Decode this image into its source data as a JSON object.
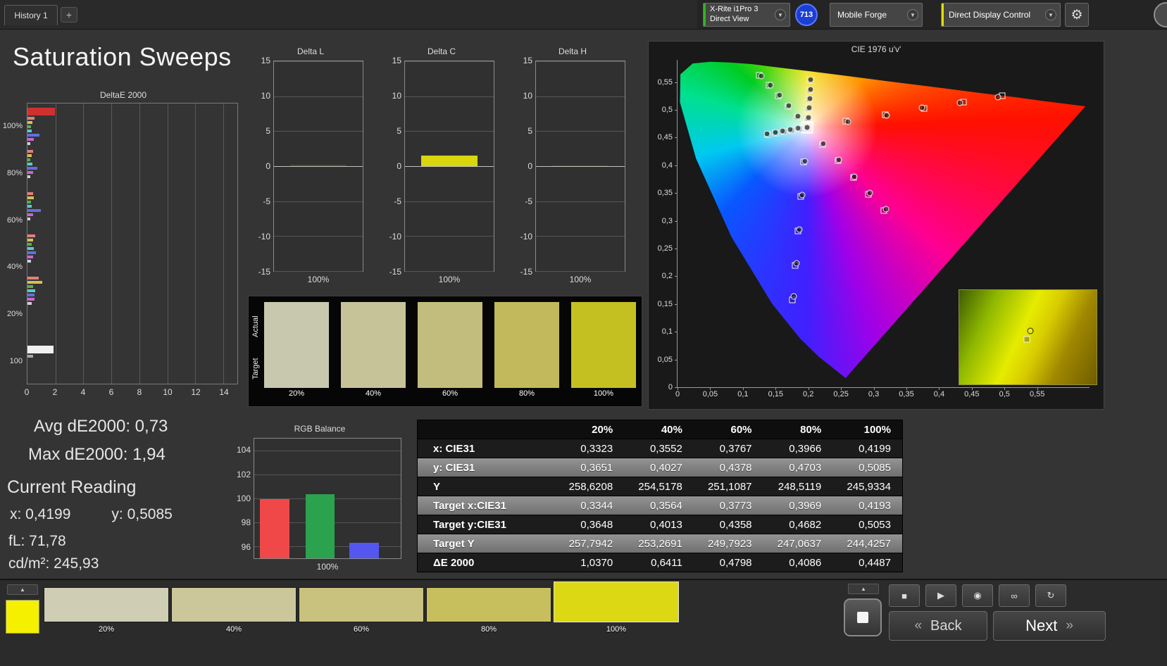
{
  "header": {
    "tab_label": "History 1",
    "add_tab_label": "+",
    "meter": {
      "line1": "X-Rite i1Pro 3",
      "line2": "Direct View",
      "badge": "713",
      "accent": "#35b324"
    },
    "source": {
      "label": "Mobile Forge"
    },
    "control": {
      "label": "Direct Display Control",
      "accent": "#e0de00"
    },
    "chevron": "▼",
    "gear_icon": "⚙"
  },
  "page": {
    "title": "Saturation Sweeps"
  },
  "stats": {
    "avg_label": "Avg dE2000: 0,73",
    "max_label": "Max dE2000: 1,94",
    "current_heading": "Current Reading",
    "x_label": "x: 0,4199",
    "y_label": "y: 0,5085",
    "fl_label": "fL: 71,78",
    "cd_label": "cd/m²: 245,93"
  },
  "swatch_panel": {
    "row_labels": [
      "Actual",
      "Target"
    ],
    "levels": [
      "20%",
      "40%",
      "60%",
      "80%",
      "100%"
    ],
    "colors": [
      "#c8c8af",
      "#c6c399",
      "#c3bd7d",
      "#c1b95c",
      "#c4c022"
    ]
  },
  "footer": {
    "current_patch_color": "#f4f000",
    "expand_icon": "▲",
    "big_stop_icon": "■",
    "swatches": [
      {
        "label": "20%",
        "color": "#cfceb4",
        "selected": false
      },
      {
        "label": "40%",
        "color": "#ccc79a",
        "selected": false
      },
      {
        "label": "60%",
        "color": "#c9c27e",
        "selected": false
      },
      {
        "label": "80%",
        "color": "#c7bf5d",
        "selected": false
      },
      {
        "label": "100%",
        "color": "#dcd914",
        "selected": true
      }
    ],
    "transport": [
      {
        "name": "stop-icon",
        "glyph": "■"
      },
      {
        "name": "play-icon",
        "glyph": "▶"
      },
      {
        "name": "record-icon",
        "glyph": "◉"
      },
      {
        "name": "loop-icon",
        "glyph": "∞"
      },
      {
        "name": "refresh-icon",
        "glyph": "↻"
      }
    ],
    "back_label": "Back",
    "next_label": "Next",
    "back_icon": "«",
    "next_icon": "»"
  },
  "chart_data": [
    {
      "id": "deltaE2000",
      "type": "bar",
      "orientation": "horizontal",
      "title": "DeltaE 2000",
      "xlim": [
        0,
        15
      ],
      "xticks": [
        0,
        2,
        4,
        6,
        8,
        10,
        12,
        14
      ],
      "groups": [
        {
          "label": "100%",
          "bars": [
            {
              "color": "#d03030",
              "value": 1.94,
              "thick": true
            },
            {
              "color": "#e08080",
              "value": 0.5
            },
            {
              "color": "#d8c050",
              "value": 0.33
            },
            {
              "color": "#58b058",
              "value": 0.24
            },
            {
              "color": "#60c8c8",
              "value": 0.3
            },
            {
              "color": "#6070e0",
              "value": 0.88
            },
            {
              "color": "#c868c8",
              "value": 0.46
            },
            {
              "color": "#d0d0d0",
              "value": 0.2
            }
          ]
        },
        {
          "label": "80%",
          "bars": [
            {
              "color": "#e08080",
              "value": 0.42
            },
            {
              "color": "#d8c050",
              "value": 0.3
            },
            {
              "color": "#58b058",
              "value": 0.22
            },
            {
              "color": "#60c8c8",
              "value": 0.35
            },
            {
              "color": "#6070e0",
              "value": 0.72
            },
            {
              "color": "#c868c8",
              "value": 0.4
            },
            {
              "color": "#d0d0d0",
              "value": 0.18
            }
          ]
        },
        {
          "label": "60%",
          "bars": [
            {
              "color": "#e08080",
              "value": 0.38
            },
            {
              "color": "#d8c050",
              "value": 0.45
            },
            {
              "color": "#58b058",
              "value": 0.25
            },
            {
              "color": "#60c8c8",
              "value": 0.32
            },
            {
              "color": "#6070e0",
              "value": 0.95
            },
            {
              "color": "#c868c8",
              "value": 0.42
            },
            {
              "color": "#d0d0d0",
              "value": 0.22
            }
          ]
        },
        {
          "label": "40%",
          "bars": [
            {
              "color": "#e08080",
              "value": 0.55
            },
            {
              "color": "#d8c050",
              "value": 0.4
            },
            {
              "color": "#58b058",
              "value": 0.3
            },
            {
              "color": "#60c8c8",
              "value": 0.45
            },
            {
              "color": "#6070e0",
              "value": 0.62
            },
            {
              "color": "#c868c8",
              "value": 0.38
            },
            {
              "color": "#d0d0d0",
              "value": 0.25
            }
          ]
        },
        {
          "label": "20%",
          "bars": [
            {
              "color": "#e08080",
              "value": 0.8
            },
            {
              "color": "#d8c050",
              "value": 1.04
            },
            {
              "color": "#58b058",
              "value": 0.42
            },
            {
              "color": "#60c8c8",
              "value": 0.55
            },
            {
              "color": "#6070e0",
              "value": 0.48
            },
            {
              "color": "#c868c8",
              "value": 0.5
            },
            {
              "color": "#d0d0d0",
              "value": 0.3
            }
          ]
        },
        {
          "label": "100",
          "bars": [
            {
              "color": "#f0f0f0",
              "value": 1.88,
              "thick": true
            },
            {
              "color": "#a8a8a8",
              "value": 0.4
            }
          ]
        }
      ]
    },
    {
      "id": "deltaL",
      "type": "bar",
      "title": "Delta L",
      "categories": [
        "100%"
      ],
      "values": [
        0.2
      ],
      "ylim": [
        -15,
        15
      ],
      "yticks": [
        15,
        10,
        5,
        0,
        -5,
        -10,
        -15
      ],
      "bar_color": "#4a4a28"
    },
    {
      "id": "deltaC",
      "type": "bar",
      "title": "Delta C",
      "categories": [
        "100%"
      ],
      "values": [
        1.5
      ],
      "ylim": [
        -15,
        15
      ],
      "yticks": [
        15,
        10,
        5,
        0,
        -5,
        -10,
        -15
      ],
      "bar_color": "#d8d60c"
    },
    {
      "id": "deltaH",
      "type": "bar",
      "title": "Delta H",
      "categories": [
        "100%"
      ],
      "values": [
        0.15
      ],
      "ylim": [
        -15,
        15
      ],
      "yticks": [
        15,
        10,
        5,
        0,
        -5,
        -10,
        -15
      ],
      "bar_color": "#4a4a28"
    },
    {
      "id": "rgbBalance",
      "type": "bar",
      "title": "RGB Balance",
      "categories": [
        "100%"
      ],
      "ylim": [
        95,
        105
      ],
      "yticks": [
        104,
        102,
        100,
        98,
        96
      ],
      "series": [
        {
          "name": "Red",
          "value": 99.95,
          "color": "#f04848"
        },
        {
          "name": "Green",
          "value": 100.35,
          "color": "#2ba24d"
        },
        {
          "name": "Blue",
          "value": 96.3,
          "color": "#5456f0"
        }
      ]
    },
    {
      "id": "cie",
      "type": "scatter",
      "title": "CIE 1976 u'v'",
      "xlim": [
        0,
        0.63
      ],
      "ylim": [
        0,
        0.59
      ],
      "tick_values": [
        0,
        0.05,
        0.1,
        0.15,
        0.2,
        0.25,
        0.3,
        0.35,
        0.4,
        0.45,
        0.5,
        0.55
      ],
      "tick_labels": [
        "0",
        "0,05",
        "0,1",
        "0,15",
        "0,2",
        "0,25",
        "0,3",
        "0,35",
        "0,4",
        "0,45",
        "0,5",
        "0,55"
      ],
      "white_point": {
        "u": 0.1978,
        "v": 0.4683
      },
      "sweeps": [
        {
          "name": "red",
          "targets": [
            [
              0.2575,
              0.4797
            ],
            [
              0.3172,
              0.4912
            ],
            [
              0.377,
              0.5026
            ],
            [
              0.4367,
              0.514
            ],
            [
              0.4964,
              0.5255
            ]
          ],
          "measured": [
            [
              0.2602,
              0.4788
            ],
            [
              0.3201,
              0.4902
            ],
            [
              0.3742,
              0.5038
            ],
            [
              0.4322,
              0.5128
            ],
            [
              0.4905,
              0.5232
            ]
          ]
        },
        {
          "name": "green",
          "targets": [
            [
              0.1832,
              0.4871
            ],
            [
              0.1687,
              0.506
            ],
            [
              0.1541,
              0.5248
            ],
            [
              0.1396,
              0.5437
            ],
            [
              0.125,
              0.5625
            ]
          ],
          "measured": [
            [
              0.1845,
              0.4886
            ],
            [
              0.1702,
              0.5078
            ],
            [
              0.1561,
              0.5266
            ],
            [
              0.1422,
              0.5449
            ],
            [
              0.1286,
              0.5602
            ]
          ]
        },
        {
          "name": "blue",
          "targets": [
            [
              0.1933,
              0.4062
            ],
            [
              0.1888,
              0.3441
            ],
            [
              0.1844,
              0.2821
            ],
            [
              0.1799,
              0.22
            ],
            [
              0.1754,
              0.1579
            ]
          ],
          "measured": [
            [
              0.1946,
              0.4078
            ],
            [
              0.1902,
              0.346
            ],
            [
              0.1858,
              0.2845
            ],
            [
              0.1815,
              0.2238
            ],
            [
              0.1777,
              0.1642
            ]
          ]
        },
        {
          "name": "cyan",
          "targets": [
            [
              0.1859,
              0.4657
            ],
            [
              0.174,
              0.4631
            ],
            [
              0.1621,
              0.4606
            ],
            [
              0.1502,
              0.458
            ],
            [
              0.1383,
              0.4554
            ]
          ],
          "measured": [
            [
              0.1846,
              0.4668
            ],
            [
              0.1728,
              0.4645
            ],
            [
              0.1609,
              0.4618
            ],
            [
              0.1492,
              0.4594
            ],
            [
              0.1371,
              0.4566
            ]
          ]
        },
        {
          "name": "magenta",
          "targets": [
            [
              0.2214,
              0.4382
            ],
            [
              0.2451,
              0.4082
            ],
            [
              0.2687,
              0.3781
            ],
            [
              0.2923,
              0.3481
            ],
            [
              0.316,
              0.318
            ]
          ],
          "measured": [
            [
              0.2228,
              0.4395
            ],
            [
              0.2466,
              0.4098
            ],
            [
              0.2705,
              0.3796
            ],
            [
              0.2945,
              0.3502
            ],
            [
              0.3189,
              0.3208
            ]
          ]
        },
        {
          "name": "yellow",
          "targets": [
            [
              0.199,
              0.4852
            ],
            [
              0.2002,
              0.5021
            ],
            [
              0.2015,
              0.5191
            ],
            [
              0.2027,
              0.536
            ],
            [
              0.2039,
              0.5529
            ]
          ],
          "measured": [
            [
              0.2001,
              0.4863
            ],
            [
              0.2014,
              0.5035
            ],
            [
              0.2026,
              0.5203
            ],
            [
              0.2038,
              0.5371
            ],
            [
              0.2033,
              0.5539
            ]
          ]
        }
      ],
      "inset_marker": {
        "x_pct": 52,
        "y_pct": 43
      }
    },
    {
      "id": "results",
      "type": "table",
      "columns": [
        "",
        "20%",
        "40%",
        "60%",
        "80%",
        "100%"
      ],
      "rows": [
        {
          "label": "x: CIE31",
          "values": [
            "0,3323",
            "0,3552",
            "0,3767",
            "0,3966",
            "0,4199"
          ]
        },
        {
          "label": "y: CIE31",
          "values": [
            "0,3651",
            "0,4027",
            "0,4378",
            "0,4703",
            "0,5085"
          ]
        },
        {
          "label": "Y",
          "values": [
            "258,6208",
            "254,5178",
            "251,1087",
            "248,5119",
            "245,9334"
          ]
        },
        {
          "label": "Target x:CIE31",
          "values": [
            "0,3344",
            "0,3564",
            "0,3773",
            "0,3969",
            "0,4193"
          ]
        },
        {
          "label": "Target y:CIE31",
          "values": [
            "0,3648",
            "0,4013",
            "0,4358",
            "0,4682",
            "0,5053"
          ]
        },
        {
          "label": "Target Y",
          "values": [
            "257,7942",
            "253,2691",
            "249,7923",
            "247,0637",
            "244,4257"
          ]
        },
        {
          "label": "ΔE 2000",
          "values": [
            "1,0370",
            "0,6411",
            "0,4798",
            "0,4086",
            "0,4487"
          ]
        }
      ]
    }
  ]
}
